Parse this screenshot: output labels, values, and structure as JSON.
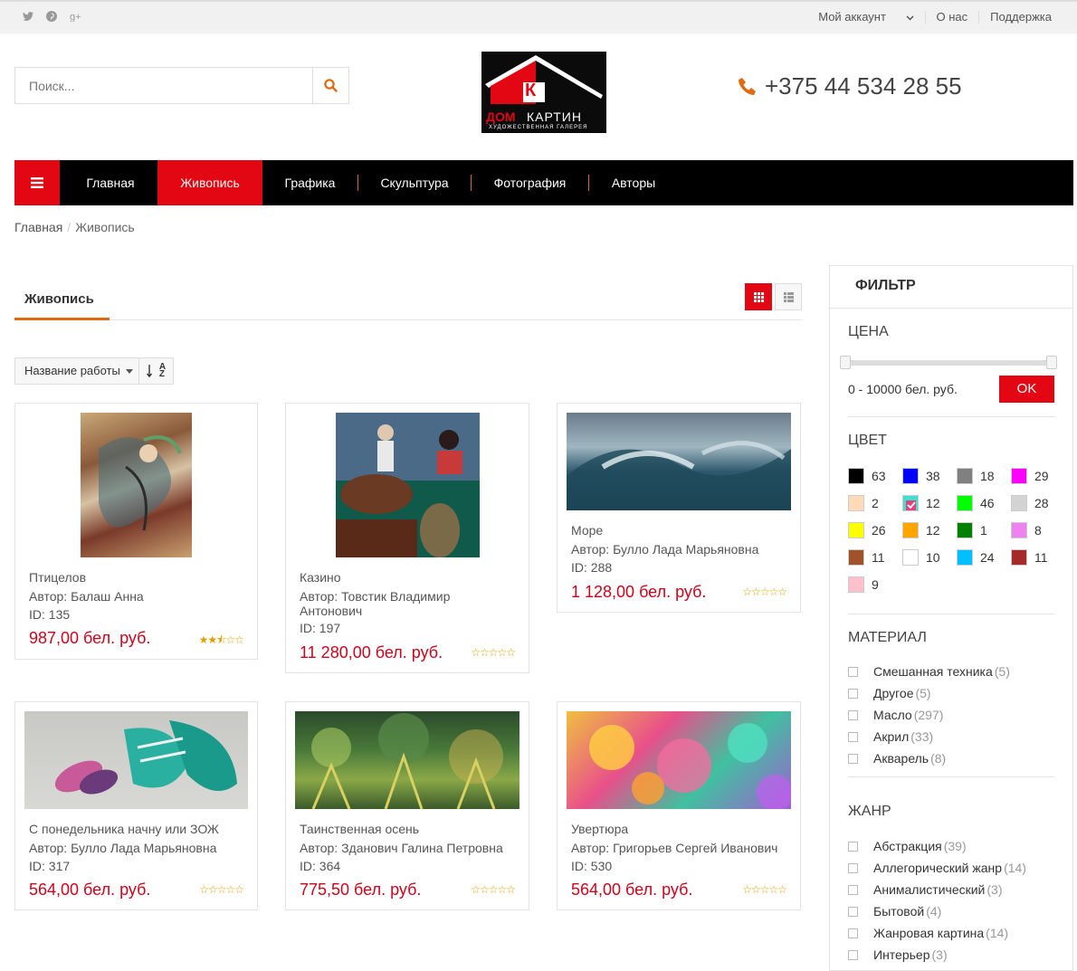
{
  "topbar": {
    "social": [
      "twitter-icon",
      "pinterest-icon",
      "google-plus-icon"
    ],
    "account": "Мой аккаунт",
    "about": "О нас",
    "support": "Поддержка"
  },
  "search": {
    "placeholder": "Поиск..."
  },
  "logo": {
    "line1": "ДОМ",
    "line2": "КАРТИН",
    "tagline": "ХУДОЖЕСТВЕННАЯ ГАЛЕРЕЯ",
    "letter": "К"
  },
  "phone": "+375 44 534 28 55",
  "nav": [
    "Главная",
    "Живопись",
    "Графика",
    "Скульптура",
    "Фотография",
    "Авторы"
  ],
  "breadcrumb": [
    "Главная",
    "Живопись"
  ],
  "section": {
    "title": "Живопись"
  },
  "sort": {
    "selected": "Название работы",
    "az_top": "A",
    "az_bottom": "Z"
  },
  "products": [
    {
      "name": "Птицелов",
      "author": "Автор: Балаш Анна",
      "id": "ID: 135",
      "price": "987,00 бел. руб.",
      "rating": 2.5
    },
    {
      "name": "Казино",
      "author": "Автор: Товстик Владимир Антонович",
      "id": "ID: 197",
      "price": "11 280,00 бел. руб.",
      "rating": 0
    },
    {
      "name": "Море",
      "author": "Автор: Булло Лада Марьяновна",
      "id": "ID: 288",
      "price": "1 128,00 бел. руб.",
      "rating": 0
    },
    {
      "name": "С понедельника начну или ЗОЖ",
      "author": "Автор: Булло Лада Марьяновна",
      "id": "ID: 317",
      "price": "564,00 бел. руб.",
      "rating": 0
    },
    {
      "name": "Таинственная осень",
      "author": "Автор: Зданович Галина Петровна",
      "id": "ID: 364",
      "price": "775,50 бел. руб.",
      "rating": 0
    },
    {
      "name": "Увертюра",
      "author": "Автор: Григорьев Сергей Иванович",
      "id": "ID: 530",
      "price": "564,00 бел. руб.",
      "rating": 0
    }
  ],
  "filter": {
    "title": "ФИЛЬТР",
    "price_title": "ЦЕНА",
    "price_range": "0 - 10000 бел. руб.",
    "ok": "OK",
    "color_title": "ЦВЕТ",
    "colors": [
      {
        "hex": "#000000",
        "count": "63"
      },
      {
        "hex": "#0000ff",
        "count": "38"
      },
      {
        "hex": "#808080",
        "count": "18"
      },
      {
        "hex": "#ff00ff",
        "count": "29"
      },
      {
        "hex": "#ffdab9",
        "count": "2"
      },
      {
        "hex": "#40e0d0",
        "count": "12",
        "checked": true
      },
      {
        "hex": "#00ff00",
        "count": "46"
      },
      {
        "hex": "#d3d3d3",
        "count": "28"
      },
      {
        "hex": "#ffff00",
        "count": "26"
      },
      {
        "hex": "#ffa500",
        "count": "12"
      },
      {
        "hex": "#008000",
        "count": "1"
      },
      {
        "hex": "#ee82ee",
        "count": "8"
      },
      {
        "hex": "#a0522d",
        "count": "11"
      },
      {
        "hex": "#ffffff",
        "count": "10"
      },
      {
        "hex": "#00bfff",
        "count": "24"
      },
      {
        "hex": "#a52a2a",
        "count": "11"
      },
      {
        "hex": "#ffc0cb",
        "count": "9"
      }
    ],
    "material_title": "МАТЕРИАЛ",
    "materials": [
      {
        "label": "Смешанная техника",
        "count": "(5)"
      },
      {
        "label": "Другое",
        "count": "(5)"
      },
      {
        "label": "Масло",
        "count": "(297)"
      },
      {
        "label": "Акрил",
        "count": "(33)"
      },
      {
        "label": "Акварель",
        "count": "(8)"
      }
    ],
    "genre_title": "ЖАНР",
    "genres": [
      {
        "label": "Абстракция",
        "count": "(39)"
      },
      {
        "label": "Аллегорический жанр",
        "count": "(14)"
      },
      {
        "label": "Анималистический",
        "count": "(3)"
      },
      {
        "label": "Бытовой",
        "count": "(4)"
      },
      {
        "label": "Жанровая картина",
        "count": "(14)"
      },
      {
        "label": "Интерьер",
        "count": "(3)"
      }
    ]
  },
  "accent": "#e30613",
  "orange": "#e06a12"
}
